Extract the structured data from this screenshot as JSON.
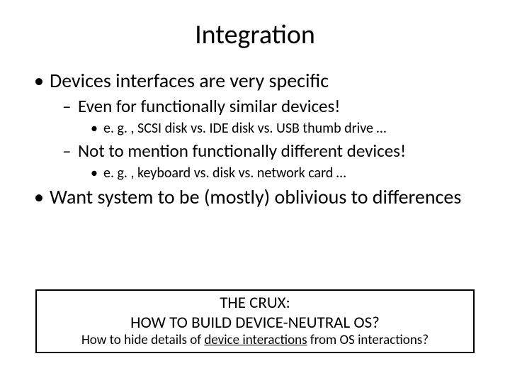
{
  "slide": {
    "title": "Integration",
    "bullets": {
      "b1a": "Devices interfaces are very specific",
      "b2a": "Even for functionally similar devices!",
      "b3a": "e. g. , SCSI disk vs. IDE disk vs. USB thumb drive …",
      "b2b": "Not to mention functionally different devices!",
      "b3b": "e. g. , keyboard vs. disk vs. network card …",
      "b1b": "Want system to be (mostly) oblivious to differences"
    },
    "crux": {
      "line1": "THE CRUX:",
      "line2": "HOW TO BUILD DEVICE-NEUTRAL OS?",
      "sub_pre": "How to hide details of ",
      "sub_ul": "device interactions",
      "sub_post": " from OS interactions?"
    }
  }
}
